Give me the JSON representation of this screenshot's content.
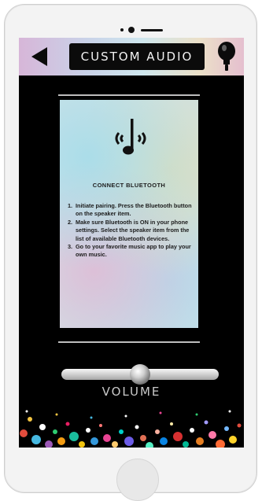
{
  "header": {
    "title": "CUSTOM AUDIO",
    "back_icon": "back-arrow-icon",
    "mic_icon": "microphone-icon"
  },
  "panel": {
    "icon": "bluetooth-speaker-icon",
    "title": "CONNECT BLUETOOTH",
    "steps": [
      {
        "num": "1.",
        "text": "Initiate pairing. Press the Bluetooth button on the speaker item."
      },
      {
        "num": "2.",
        "text": "Make sure Bluetooth is ON in your phone settings. Select the speaker item from the list of available Bluetooth devices."
      },
      {
        "num": "3.",
        "text": "Go to your favorite music app to play your own music."
      }
    ]
  },
  "volume": {
    "label": "VOLUME",
    "level": 0.5
  },
  "colors": {
    "screen_bg": "#000000",
    "header_gradient": [
      "#d7b6d8",
      "#cfe7ee",
      "#e5bfcf"
    ]
  }
}
